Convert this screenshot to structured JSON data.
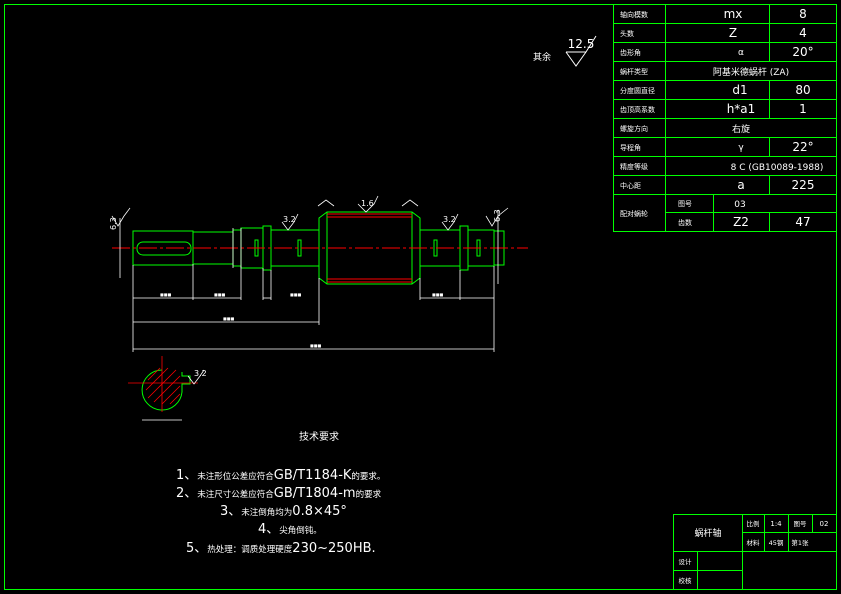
{
  "params": [
    {
      "label": "轴向模数",
      "symbol": "mx",
      "value": "8"
    },
    {
      "label": "头数",
      "symbol": "Z",
      "value": "4"
    },
    {
      "label": "齿形角",
      "symbol": "α",
      "value": "20°"
    },
    {
      "label": "蜗杆类型",
      "merged": "阿基米德蜗杆 (ZA)"
    },
    {
      "label": "分度圆直径",
      "symbol": "d1",
      "value": "80"
    },
    {
      "label": "齿顶高系数",
      "symbol": "h*a1",
      "value": "1"
    },
    {
      "label": "螺旋方向",
      "merged": "右旋"
    },
    {
      "label": "导程角",
      "symbol": "γ",
      "value": "22°"
    },
    {
      "label": "精度等级",
      "merged": "8 C (GB10089-1988)"
    },
    {
      "label": "中心距",
      "symbol": "a",
      "value": "225"
    }
  ],
  "mate": {
    "label": "配对蜗轮",
    "rows": [
      {
        "label": "图号",
        "value": "03"
      },
      {
        "label": "齿数",
        "symbol": "Z2",
        "value": "47"
      }
    ]
  },
  "roughness": {
    "prefix": "其余",
    "value": "12.5"
  },
  "drawing_marks": {
    "r1": "6.3",
    "r2": "3.2",
    "r3": "1.6",
    "r4": "3.2",
    "r5": "6.3",
    "r6": "3.2"
  },
  "notes": {
    "title": "技术要求",
    "items": [
      {
        "num": "1、",
        "cn": "未注形位公差应符合",
        "std": "GB/T1184-K",
        "tail": "的要求。"
      },
      {
        "num": "2、",
        "cn": "未注尺寸公差应符合",
        "std": "GB/T1804-m",
        "tail": "的要求"
      },
      {
        "num": "3、",
        "cn": "未注倒角均为",
        "std": "0.8×45°",
        "tail": ""
      },
      {
        "num": "4、",
        "cn": "尖角倒钝。",
        "std": "",
        "tail": ""
      },
      {
        "num": "5、",
        "cn": "热处理：调质处理硬度",
        "std": "230~250HB.",
        "tail": ""
      }
    ]
  },
  "titleblock": {
    "part_name": "蜗杆轴",
    "scale_label": "比例",
    "scale_value": "1:4",
    "drawing_no_label": "图号",
    "drawing_no_value": "02",
    "material_label": "材料",
    "material_value": "45钢",
    "sheet_value": "第1张",
    "designer_label": "设计",
    "checker_label": "校核"
  },
  "colors": {
    "line": "#00ff00",
    "center": "#ff0000",
    "dim": "#ffffff",
    "hatch": "#ff0000",
    "bg": "#000000"
  }
}
